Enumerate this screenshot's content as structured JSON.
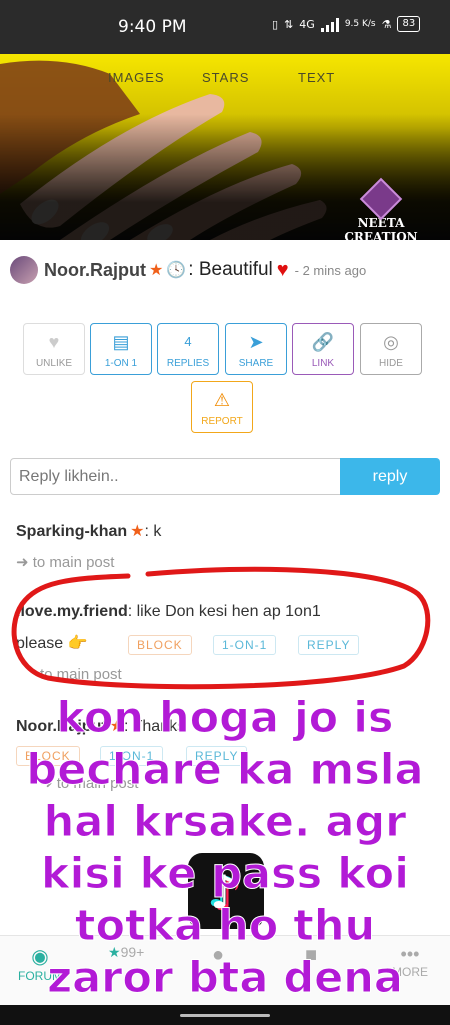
{
  "status_bar": {
    "time": "9:40 PM",
    "network": "4G",
    "speed": "9.5 K/s",
    "battery": "83"
  },
  "banner": {
    "tabs": [
      "IMAGES",
      "STARS",
      "TEXT"
    ],
    "brand_logo": "NC",
    "brand_name": "NEETA CREATION"
  },
  "post": {
    "author": "Noor.Rajput",
    "text": ": Beautiful",
    "time_ago": "- 2 mins ago"
  },
  "actions": {
    "unlike": "UNLIKE",
    "one_on_one": "1-ON 1",
    "replies_count": "4",
    "replies": "REPLIES",
    "share": "SHARE",
    "link": "LINK",
    "hide": "HIDE",
    "report": "REPORT"
  },
  "reply_bar": {
    "placeholder": "Reply likhein..",
    "button": "reply"
  },
  "comments": [
    {
      "user": "Sparking-khan",
      "text": ": k",
      "to_main": "➜ to main post"
    },
    {
      "user": ".love.my.friend",
      "text": ": like Don kesi hen ap 1on1",
      "text2": "please",
      "block": "BLOCK",
      "one_on_one": "1-ON-1",
      "reply": "REPLY",
      "to_main": "to main post"
    },
    {
      "user": "Noor.Rajput",
      "text": ": Thanks",
      "block": "BLOCK",
      "one_on_one": "1-ON-1",
      "reply": "REPLY",
      "to_main": "➜ to main post"
    }
  ],
  "bottom_nav": {
    "forum": "FORUM",
    "stars_count": "99+",
    "more": "MORE"
  },
  "overlay_caption": [
    "kon hoga jo is",
    "bechare ka msla",
    "hal krsake. agr",
    "kisi ke pass koi",
    "totka ho thu",
    "zaror bta dena"
  ]
}
